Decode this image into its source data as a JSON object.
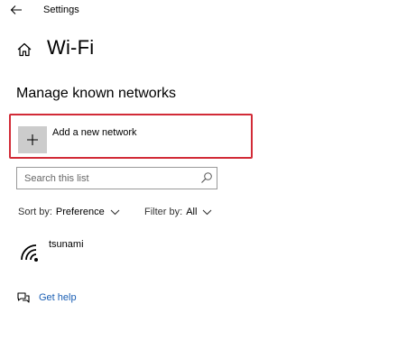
{
  "window": {
    "title": "Settings",
    "back_icon": "arrow-left-icon"
  },
  "page": {
    "home_icon": "home-icon",
    "title": "Wi-Fi"
  },
  "section": {
    "title": "Manage known networks"
  },
  "add_network": {
    "icon": "plus-icon",
    "label": "Add a new network",
    "highlight_color": "#d22b37"
  },
  "search": {
    "placeholder": "Search this list",
    "value": "",
    "icon": "search-icon"
  },
  "sort": {
    "label": "Sort by:",
    "value": "Preference",
    "icon": "chevron-down-icon"
  },
  "filter": {
    "label": "Filter by:",
    "value": "All",
    "icon": "chevron-down-icon"
  },
  "networks": [
    {
      "name": "tsunami",
      "icon": "wifi-icon"
    }
  ],
  "help": {
    "label": "Get help",
    "icon": "help-chat-icon",
    "link_color": "#1a5fb4"
  }
}
